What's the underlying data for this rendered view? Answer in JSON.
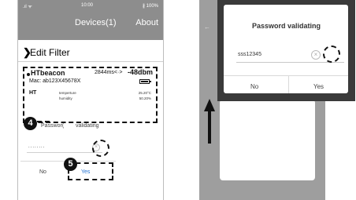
{
  "left_phone": {
    "status": {
      "signal": ".ıl ᯤ",
      "time": "10:00",
      "battery": "∦ 100%"
    },
    "header": {
      "title": "Devices(1)",
      "about": "About"
    },
    "filter": {
      "label": "Edit Filter"
    },
    "device": {
      "name": "HTbeacon",
      "interval": "2844ms<·>",
      "rssi": "-48dbm",
      "mac": "Mac: ab123X45678X",
      "type": "HT",
      "measurements": [
        {
          "label": "temperture",
          "value": "25.20°C"
        },
        {
          "label": "humidity",
          "value": "50.20%"
        }
      ]
    },
    "marker": "4"
  },
  "right_phone": {
    "dialog_small": {
      "title_a": "Passwor(",
      "title_b": "validating",
      "password_masked": "........",
      "no_label": "No",
      "yes_label": "Yes"
    },
    "marker": "5",
    "dialog_zoom": {
      "title": "Password validating",
      "input_value": "sss12345",
      "clear_glyph": "×",
      "no_label": "No",
      "yes_label": "Yes"
    }
  },
  "colors": {
    "header": "#8d8d8d",
    "overlay": "#9e9e9e",
    "accent": "#1f6fd1",
    "annotation": "#111111"
  }
}
